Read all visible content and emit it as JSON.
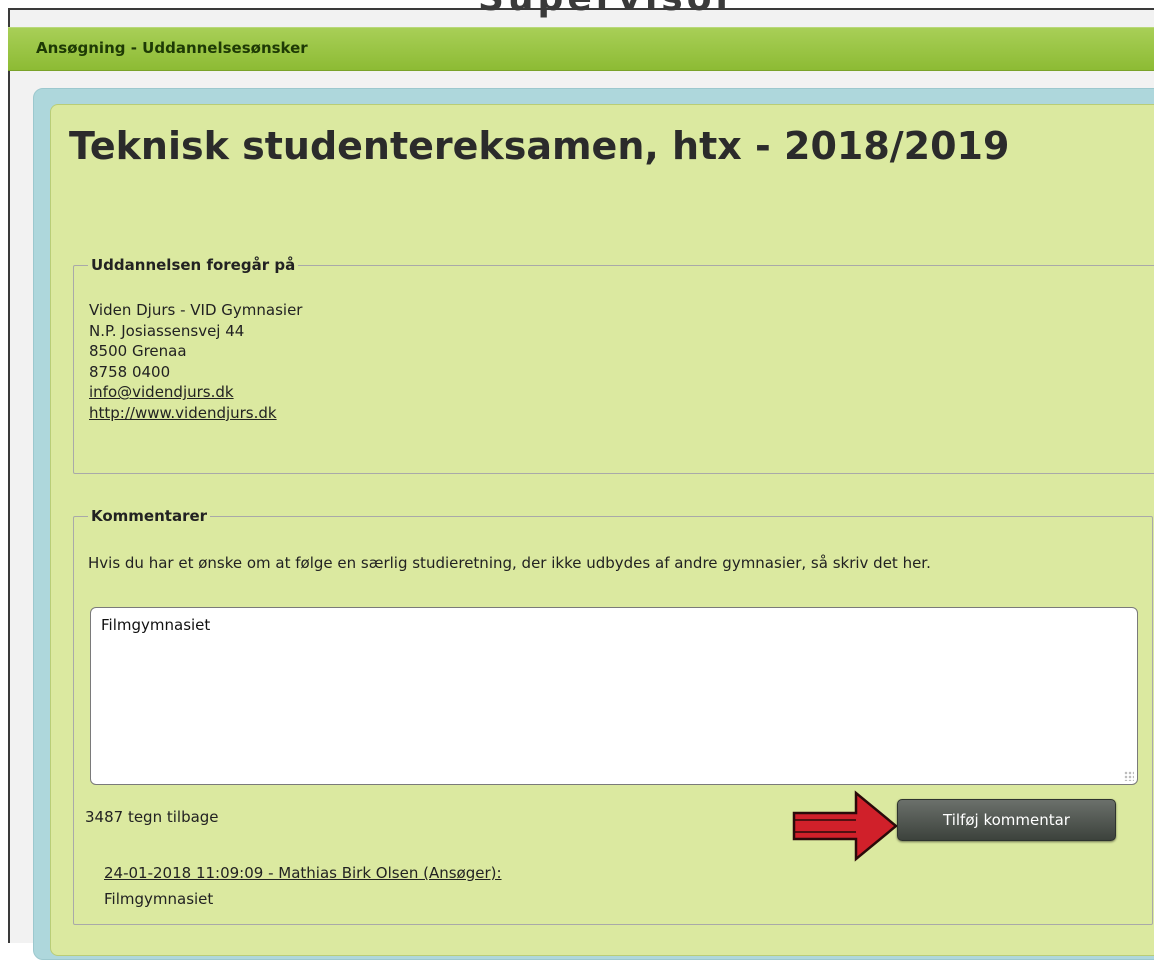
{
  "window": {
    "background_title": "Supervisor",
    "dialog_title": "Ansøgning - Uddannelsesønsker"
  },
  "education": {
    "title": "Teknisk studentereksamen, htx - 2018/2019"
  },
  "school": {
    "legend": "Uddannelsen foregår på",
    "name": "Viden Djurs - VID Gymnasier",
    "street": "N.P. Josiassensvej 44",
    "city": "8500 Grenaa",
    "phone": "8758 0400",
    "email": "info@videndjurs.dk",
    "website": "http://www.videndjurs.dk"
  },
  "comments": {
    "legend": "Kommentarer",
    "help_text": "Hvis du har et ønske om at følge en særlig studieretning, der ikke udbydes af andre gymnasier, så skriv det her.",
    "input_value": "Filmgymnasiet",
    "chars_left": "3487 tegn tilbage",
    "add_button_label": "Tilføj kommentar",
    "entries": [
      {
        "header": "24-01-2018 11:09:09 - Mathias Birk Olsen (Ansøger):",
        "text": "Filmgymnasiet"
      }
    ]
  },
  "colors": {
    "titlebar": "#8dbb34",
    "outer_panel": "#aed7dc",
    "inner_panel": "#dbe9a0",
    "button": "#4a504a",
    "annotation_arrow": "#d0202a"
  },
  "icons": {
    "annotation": "red-arrow-icon",
    "textarea_resize": "resize-grip-icon"
  }
}
